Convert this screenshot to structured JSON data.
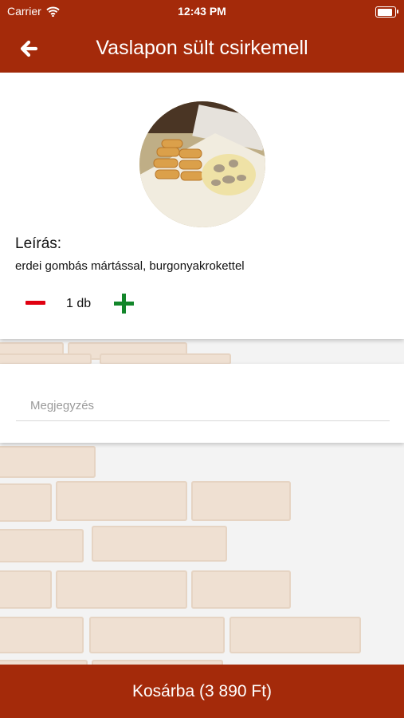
{
  "status": {
    "carrier": "Carrier",
    "time": "12:43 PM",
    "battery_level": 1.0
  },
  "nav": {
    "title": "Vaslapon sült csirkemell",
    "back_icon": "arrow-left-icon"
  },
  "item": {
    "description_label": "Leírás:",
    "description": "erdei gombás mártással, burgonyakrokettel",
    "quantity": "1 db"
  },
  "note": {
    "placeholder": "Megjegyzés",
    "value": ""
  },
  "cart": {
    "label": "Kosárba (3 890 Ft)"
  },
  "colors": {
    "brand": "#a42a0a",
    "minus": "#e00010",
    "plus": "#12862a"
  }
}
